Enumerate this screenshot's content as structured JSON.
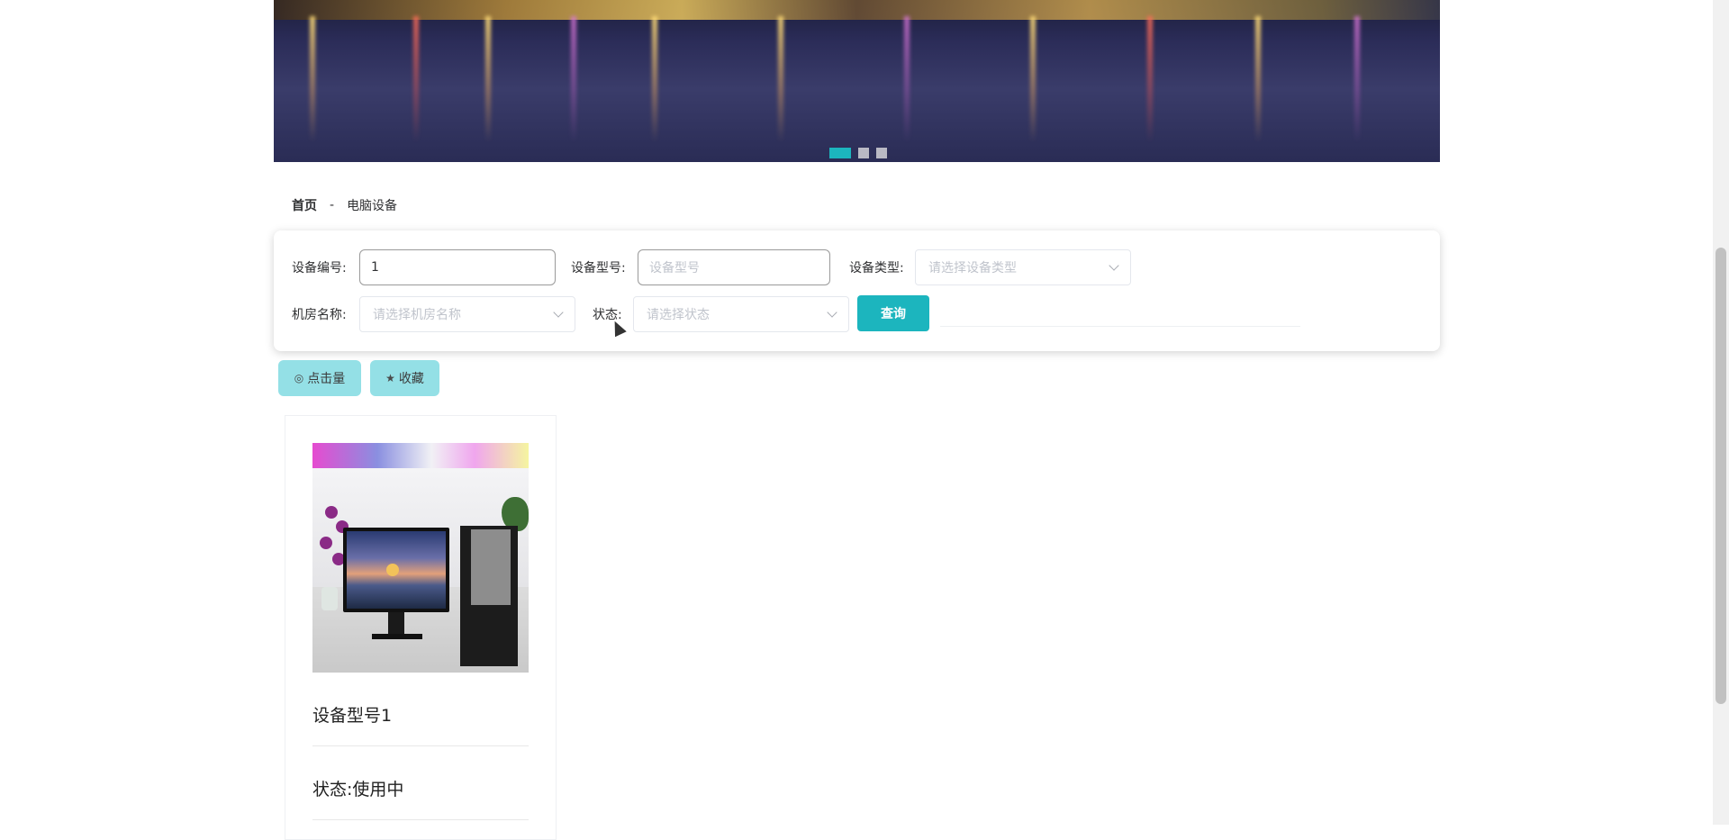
{
  "banner": {
    "slides_total": 3,
    "active_slide": 1
  },
  "breadcrumb": {
    "home": "首页",
    "separator": "-",
    "current": "电脑设备"
  },
  "search": {
    "device_no_label": "设备编号:",
    "device_no_value": "1",
    "device_model_label": "设备型号:",
    "device_model_placeholder": "设备型号",
    "device_type_label": "设备类型:",
    "device_type_placeholder": "请选择设备类型",
    "room_name_label": "机房名称:",
    "room_name_placeholder": "请选择机房名称",
    "status_label": "状态:",
    "status_placeholder": "请选择状态",
    "query_button": "查询"
  },
  "sort": {
    "clicks_icon": "eye-icon",
    "clicks_label": "点击量",
    "favorites_icon": "star-icon",
    "favorites_label": "收藏"
  },
  "cards": [
    {
      "title": "设备型号1",
      "status": "状态:使用中"
    }
  ],
  "colors": {
    "accent": "#1cb5be",
    "sort_button_bg": "#94e0e6"
  }
}
